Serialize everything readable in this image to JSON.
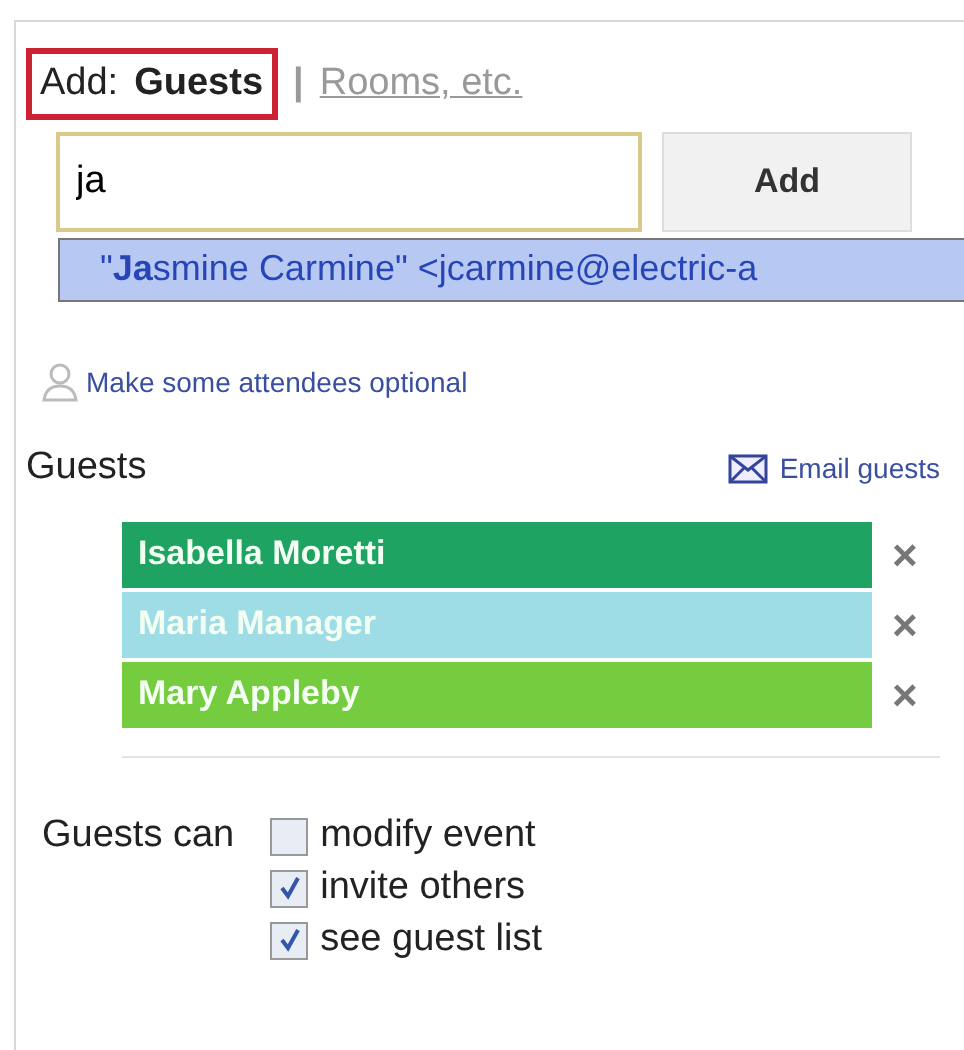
{
  "add_tabs": {
    "label": "Add:",
    "separator": "|",
    "tabs": [
      {
        "label": "Guests",
        "selected": true
      },
      {
        "label": "Rooms, etc.",
        "selected": false
      }
    ]
  },
  "guest_input": {
    "value": "ja",
    "button": "Add"
  },
  "suggestion": "\"**Ja**smine Carmine\" <jcarmine@electric-a",
  "optional_link": "Make some attendees optional",
  "guests": {
    "title": "Guests",
    "email_link": "Email guests",
    "remove": "×",
    "items": [
      {
        "name": "Isabella Moretti",
        "color": "#1ea362"
      },
      {
        "name": "Maria Manager",
        "color": "#9fdde6"
      },
      {
        "name": "Mary Appleby",
        "color": "#74cc3e"
      }
    ]
  },
  "permissions": {
    "label": "Guests can",
    "options": [
      {
        "label": "modify event",
        "checked": false
      },
      {
        "label": "invite others",
        "checked": true
      },
      {
        "label": "see guest list",
        "checked": true
      }
    ]
  }
}
